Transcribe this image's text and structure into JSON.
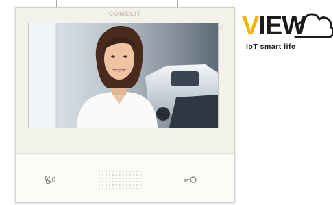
{
  "device": {
    "brand": "COMELIT",
    "buttons": {
      "talk_icon": "handset-icon",
      "door_icon": "key-icon"
    }
  },
  "logo": {
    "first_letter": "V",
    "rest": "IEW",
    "tagline": "IoT smart life",
    "accent_color": "#f4b400"
  }
}
